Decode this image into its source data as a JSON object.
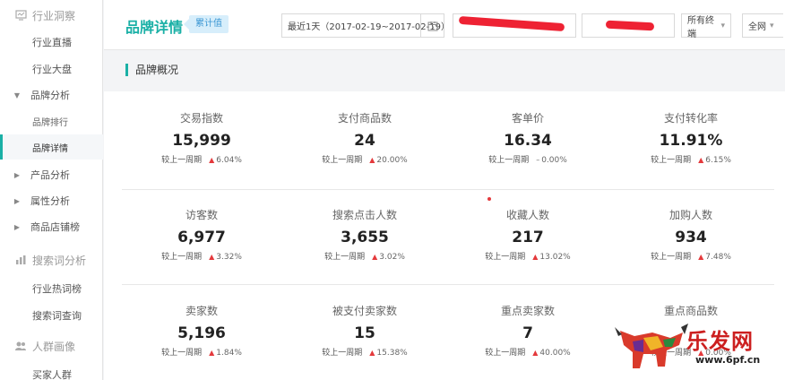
{
  "sidebar": {
    "group_industry": "行业洞察",
    "industry_live": "行业直播",
    "industry_overview": "行业大盘",
    "brand_analysis": "品牌分析",
    "brand_rank": "品牌排行",
    "brand_detail": "品牌详情",
    "product_analysis": "产品分析",
    "attribute_analysis": "属性分析",
    "goods_store_rank": "商品店铺榜",
    "group_search": "搜索词分析",
    "industry_hot_words": "行业热词榜",
    "search_word_query": "搜索词查询",
    "group_persona": "人群画像",
    "buyer_crowd": "买家人群"
  },
  "header": {
    "title": "品牌详情",
    "badge": "累计值",
    "date_range": "最近1天（2017-02-19~2017-02-19）",
    "terminal": "所有终端",
    "network": "全网"
  },
  "section": {
    "title": "品牌概况"
  },
  "metrics": [
    {
      "label": "交易指数",
      "value": "15,999",
      "compare": "较上一周期",
      "change": "6.04%"
    },
    {
      "label": "支付商品数",
      "value": "24",
      "compare": "较上一周期",
      "change": "20.00%"
    },
    {
      "label": "客单价",
      "value": "16.34",
      "compare": "较上一周期",
      "change": "0.00%"
    },
    {
      "label": "支付转化率",
      "value": "11.91%",
      "compare": "较上一周期",
      "change": "6.15%"
    },
    {
      "label": "访客数",
      "value": "6,977",
      "compare": "较上一周期",
      "change": "3.32%"
    },
    {
      "label": "搜索点击人数",
      "value": "3,655",
      "compare": "较上一周期",
      "change": "3.02%"
    },
    {
      "label": "收藏人数",
      "value": "217",
      "compare": "较上一周期",
      "change": "13.02%"
    },
    {
      "label": "加购人数",
      "value": "934",
      "compare": "较上一周期",
      "change": "7.48%"
    },
    {
      "label": "卖家数",
      "value": "5,196",
      "compare": "较上一周期",
      "change": "1.84%"
    },
    {
      "label": "被支付卖家数",
      "value": "15",
      "compare": "较上一周期",
      "change": "15.38%"
    },
    {
      "label": "重点卖家数",
      "value": "7",
      "compare": "较上一周期",
      "change": "40.00%"
    },
    {
      "label": "重点商品数",
      "value": "",
      "compare": "较上一周期",
      "change": "0.00%"
    }
  ],
  "watermark": {
    "brand": "乐发网",
    "url": "www.6pf.cn"
  },
  "colors": {
    "accent": "#1ab0a6",
    "up": "#e4393c",
    "redaction": "#ee2233",
    "badge_bg": "#d7eefb"
  },
  "icons": [
    "monitor-icon",
    "bar-chart-icon",
    "users-icon",
    "calendar-icon",
    "caret-down-icon",
    "chevron-down-icon",
    "arrow-up-icon"
  ]
}
